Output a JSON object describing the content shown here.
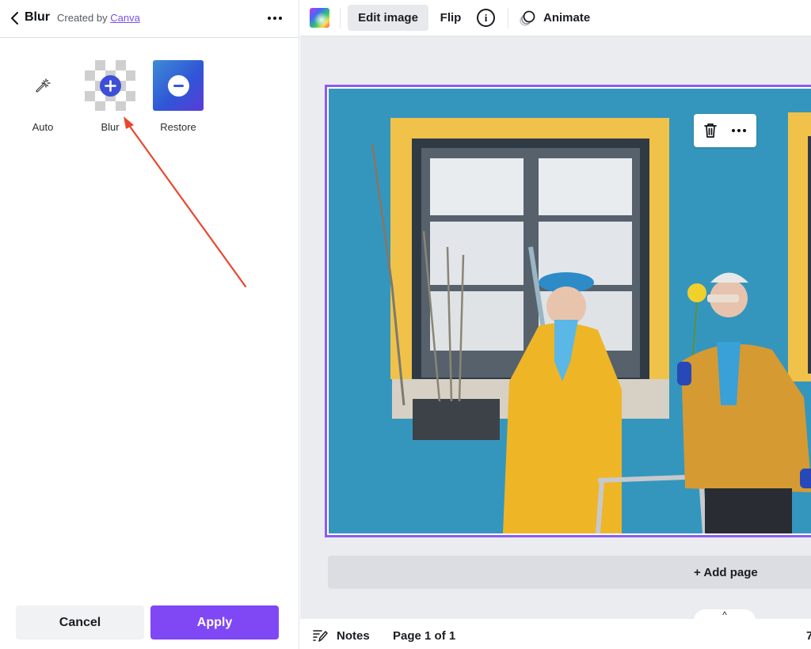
{
  "panel": {
    "title": "Blur",
    "created_by_prefix": "Created by",
    "created_by_link": "Canva",
    "tools": [
      {
        "label": "Auto",
        "icon": "magic-wand-icon"
      },
      {
        "label": "Blur",
        "icon": "plus-circle-icon"
      },
      {
        "label": "Restore",
        "icon": "minus-circle-icon"
      }
    ],
    "cancel_label": "Cancel",
    "apply_label": "Apply"
  },
  "toolbar": {
    "edit_image_label": "Edit image",
    "flip_label": "Flip",
    "info_glyph": "i",
    "animate_label": "Animate"
  },
  "canvas": {
    "image_description": "Elderly couple in yellow sweaters in front of blue wall with yellow-framed window",
    "context_menu": [
      "trash-icon",
      "more-icon"
    ]
  },
  "add_page_label": "+ Add page",
  "footer": {
    "collapse_glyph": "^",
    "notes_label": "Notes",
    "page_indicator": "Page 1 of 1",
    "zoom_partial": "7"
  },
  "colors": {
    "accent": "#8047f5",
    "selection": "#8b5cf0",
    "link": "#7d4fe8",
    "annotation_arrow": "#e8482e"
  }
}
